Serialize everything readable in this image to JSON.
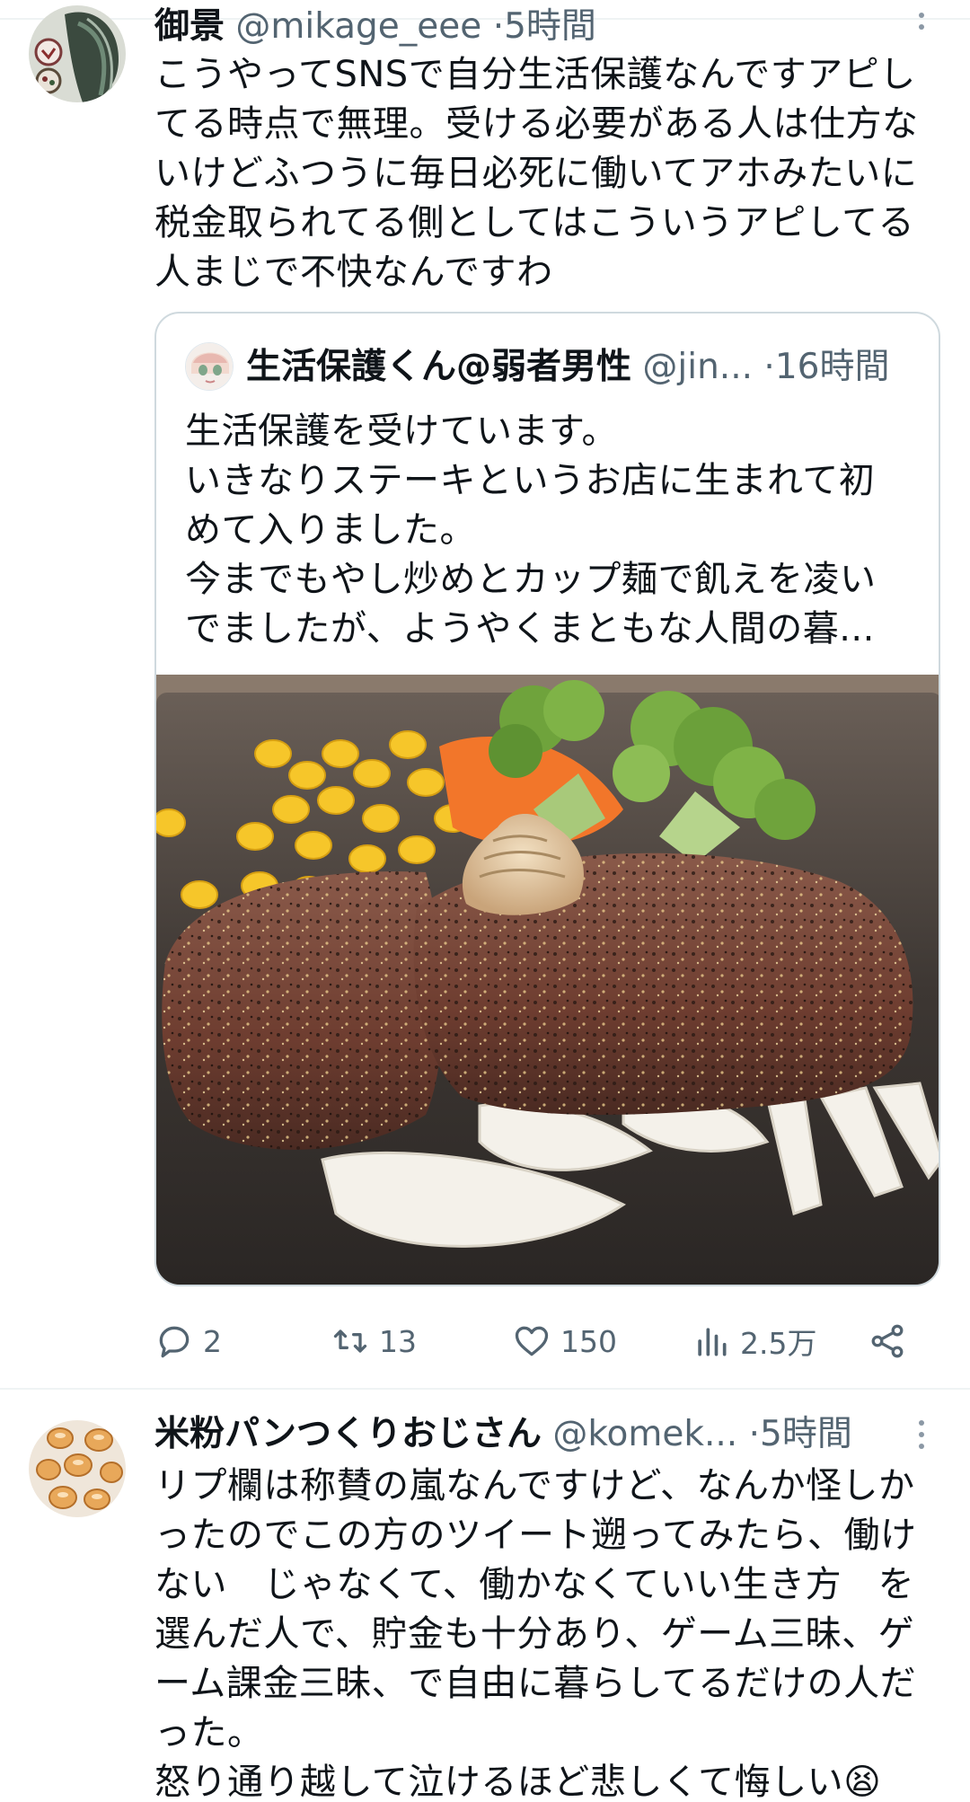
{
  "tweet1": {
    "name": "御景",
    "handle": "@mikage_eee",
    "separator": "·",
    "time": "5時間",
    "text": "こうやってSNSで自分生活保護なんですアピし\nてる時点で無理。受ける必要がある人は仕方な\nいけどふつうに毎日必死に働いてアホみたいに\n税金取られてる側としてはこういうアピしてる\n人まじで不快なんですわ",
    "quote": {
      "name": "生活保護くん@弱者男性",
      "handle": "@jin...",
      "separator": "·",
      "time": "16時間",
      "text": "生活保護を受けています。\nいきなりステーキというお店に生まれて初\nめて入りました。\n今までもやし炒めとカップ麺で飢えを凌い\nでましたが、ようやくまともな人間の暮..."
    },
    "actions": {
      "replies": "2",
      "retweets": "13",
      "likes": "150",
      "views": "2.5万"
    }
  },
  "tweet2": {
    "name": "米粉パンつくりおじさん",
    "handle": "@komek...",
    "separator": "·",
    "time": "5時間",
    "text": "リプ欄は称賛の嵐なんですけど、なんか怪しか\nったのでこの方のツイート遡ってみたら、働け\nない　じゃなくて、働かなくていい生き方　を\n選んだ人で、貯金も十分あり、ゲーム三昧、ゲ\nーム課金三昧、で自由に暮らしてるだけの人だ\nった。\n怒り通り越して泣けるほど悲しくて悔しい😫"
  },
  "colors": {
    "text": "#0f1419",
    "secondary": "#536471",
    "border": "#cfd9de"
  },
  "icons": [
    "reply-icon",
    "retweet-icon",
    "like-icon",
    "views-icon",
    "share-icon",
    "more-icon"
  ]
}
